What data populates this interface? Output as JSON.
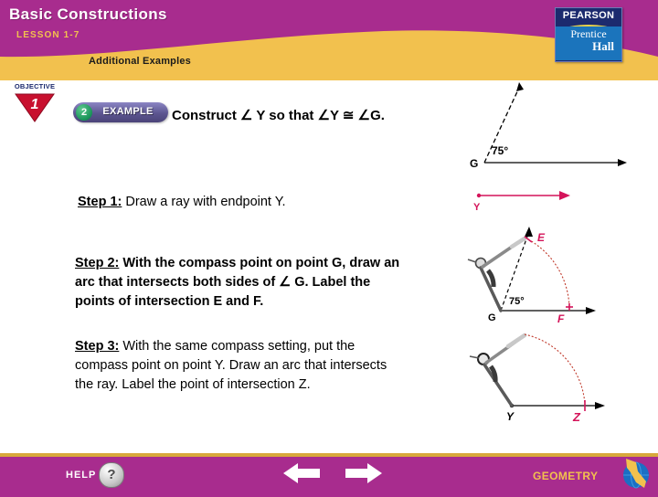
{
  "header": {
    "title": "Basic Constructions",
    "lesson": "LESSON 1-7",
    "additional_examples": "Additional Examples",
    "logo": {
      "pearson": "PEARSON",
      "prentice": "Prentice",
      "hall": "Hall"
    }
  },
  "objective": {
    "word": "OBJECTIVE",
    "number": "1"
  },
  "example": {
    "number": "2",
    "label": "EXAMPLE"
  },
  "main": {
    "prompt_prefix": "Construct ",
    "prompt": "Construct ∠ Y so that ∠Y ≅ ∠G.",
    "steps": [
      {
        "label": "Step 1:",
        "text": " Draw a ray with endpoint Y."
      },
      {
        "label": "Step 2:",
        "text": " With the compass point on point G, draw an arc that intersects both sides of ∠ G. Label the points of intersection E and F."
      },
      {
        "label": "Step 3:",
        "text": " With the same compass setting, put the compass point on point Y. Draw an arc that intersects the ray. Label the point of intersection Z."
      }
    ]
  },
  "diagrams": {
    "d1": {
      "angle_label": "75°",
      "vertex_label": "G",
      "ray_label": "Y"
    },
    "d2": {
      "angle_label": "75°",
      "vertex_label": "G",
      "point_e": "E",
      "point_f": "F"
    },
    "d3": {
      "vertex_label": "Y",
      "point_z": "Z"
    }
  },
  "footer": {
    "help_label": "HELP",
    "help_glyph": "?",
    "geometry_label": "GEOMETRY"
  },
  "colors": {
    "magenta": "#A82C8E",
    "gold": "#F2C14E",
    "navy": "#1C2A6E",
    "red": "#D4145A",
    "arc_red": "#C0392B"
  }
}
